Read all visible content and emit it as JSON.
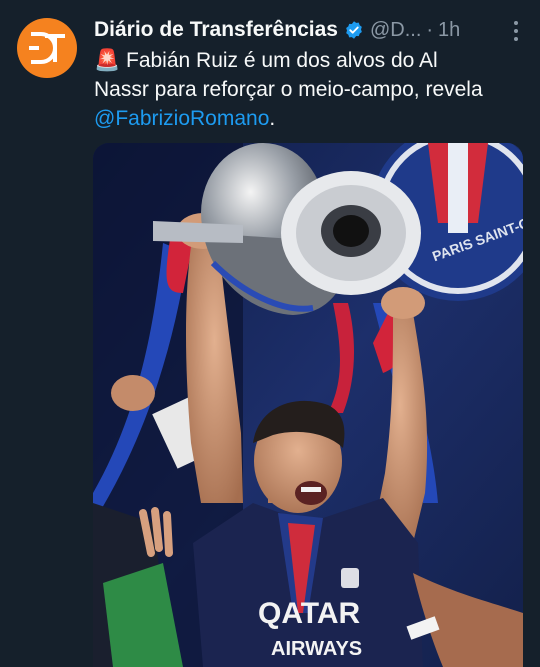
{
  "tweet": {
    "display_name": "Diário de Transferências",
    "handle": "@D...",
    "separator": "·",
    "time": "1h",
    "text_line1": "Fabián Ruiz é um dos alvos do Al",
    "text_line2_pre": "Nassr para reforçar o meio-campo, revela",
    "mention": "@FabrizioRomano",
    "text_end": ".",
    "emoji": "🚨"
  },
  "media": {
    "shirt_text": "QATAR",
    "shirt_text2": "AIRWAYS",
    "badge_text": "PARIS SAINT-GERMAIN"
  },
  "colors": {
    "background": "#15202b",
    "link": "#1d9bf0",
    "secondary_text": "#8b98a5",
    "avatar": "#f5821f",
    "verified": "#1d9bf0"
  },
  "icons": [
    "avatar-logo",
    "verified-icon",
    "more-icon",
    "alarm-emoji"
  ]
}
